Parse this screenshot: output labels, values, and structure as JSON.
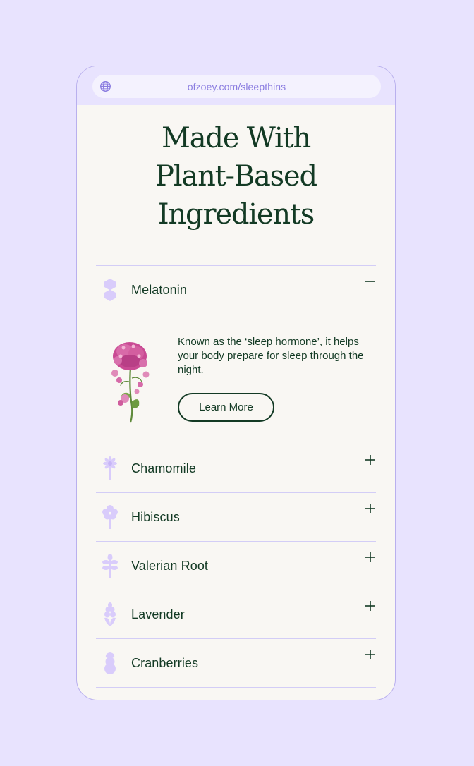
{
  "browser": {
    "url": "ofzoey.com/sleepthins"
  },
  "page": {
    "headline": [
      "Made With",
      "Plant-Based",
      "Ingredients"
    ]
  },
  "ingredients": [
    {
      "label": "Melatonin",
      "icon": "hexagon-molecule-icon",
      "expanded": true,
      "description": "Known as the ‘sleep hormone’, it helps your body prepare for sleep through the night.",
      "button_label": "Learn More"
    },
    {
      "label": "Chamomile",
      "icon": "chamomile-icon",
      "expanded": false
    },
    {
      "label": "Hibiscus",
      "icon": "hibiscus-icon",
      "expanded": false
    },
    {
      "label": "Valerian Root",
      "icon": "valerian-leaf-icon",
      "expanded": false
    },
    {
      "label": "Lavender",
      "icon": "lavender-icon",
      "expanded": false
    },
    {
      "label": "Cranberries",
      "icon": "cranberry-icon",
      "expanded": false
    }
  ],
  "colors": {
    "background": "#e8e3fe",
    "card": "#f9f7f3",
    "text": "#133a24",
    "accent": "#8a7ce0",
    "icon": "#d9ccfb",
    "divider": "#d3cdf6"
  }
}
